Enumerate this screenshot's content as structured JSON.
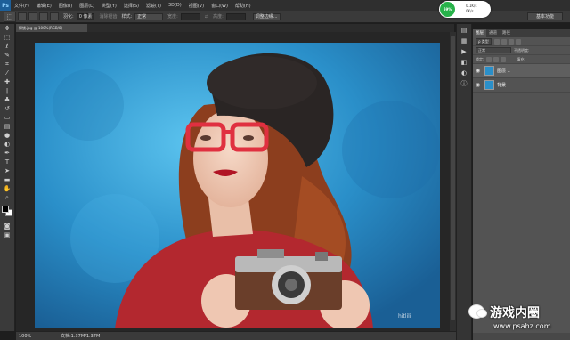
{
  "app": {
    "logo": "Ps",
    "menu": [
      "文件(F)",
      "编辑(E)",
      "图像(I)",
      "图层(L)",
      "类型(Y)",
      "选择(S)",
      "滤镜(T)",
      "3D(D)",
      "视图(V)",
      "窗口(W)",
      "帮助(H)"
    ]
  },
  "options": {
    "feather_label": "羽化:",
    "feather_value": "0 像素",
    "antialias_label": "消除锯齿",
    "style_label": "样式:",
    "style_value": "正常",
    "width_label": "宽度:",
    "height_label": "高度:",
    "refine_label": "调整边缘...",
    "workspace": "基本功能"
  },
  "widget": {
    "percent": "59%",
    "up": "0.1K/s",
    "down": "0K/s"
  },
  "document": {
    "tab_title": "解锁.jpg @ 100%(RGB/8)",
    "zoom": "100%",
    "doc_info": "文档:1.37M/1.37M"
  },
  "layers_panel": {
    "tabs": [
      "图层",
      "通道",
      "路径"
    ],
    "filter_label": "ρ 类型",
    "blend_mode": "正常",
    "opacity_label": "不透明度:",
    "lock_label": "锁定:",
    "fill_label": "填充:",
    "layers": [
      {
        "name": "图层 1"
      },
      {
        "name": "背景"
      }
    ]
  },
  "watermark": {
    "handle": "hitlili",
    "title": "游戏内圈",
    "url": "www.psahz.com"
  },
  "icons": {
    "move": "move-icon",
    "marquee": "marquee-icon",
    "lasso": "lasso-icon",
    "eye": "eye-icon"
  },
  "colors": {
    "accent": "#2a8fc9",
    "widget_green": "#27b24a",
    "glasses_red": "#e03040"
  }
}
